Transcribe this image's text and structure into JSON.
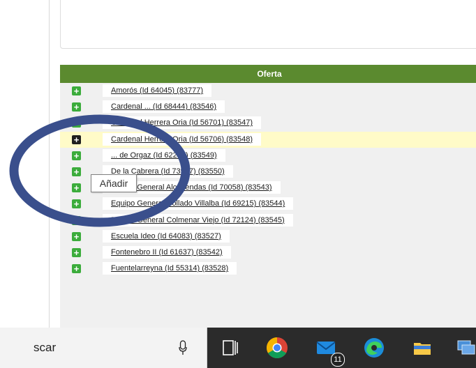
{
  "panel": {
    "header_label": "Oferta",
    "rows": [
      {
        "text": "Amorós (Id 64045) (83777)",
        "highlighted": false
      },
      {
        "text": "Cardenal ... (Id 68444) (83546)",
        "highlighted": false
      },
      {
        "text": "Cardenal Herrera Oria (Id 56701) (83547)",
        "highlighted": false
      },
      {
        "text": "Cardenal Herrera Oria (Id 56706) (83548)",
        "highlighted": true
      },
      {
        "text": "... de Orgaz (Id 62219) (83549)",
        "highlighted": false
      },
      {
        "text": "De la Cabrera (Id 73957) (83550)",
        "highlighted": false
      },
      {
        "text": "Equipo General Alcobendas (Id 70058) (83543)",
        "highlighted": false
      },
      {
        "text": "Equipo General Collado Villalba (Id 69215) (83544)",
        "highlighted": false
      },
      {
        "text": "Equipo General Colmenar Viejo (Id 72124) (83545)",
        "highlighted": false
      },
      {
        "text": "Escuela Ideo (Id 64083) (83527)",
        "highlighted": false
      },
      {
        "text": "Fontenebro II (Id 61637) (83542)",
        "highlighted": false
      },
      {
        "text": "Fuentelarreyna (Id 55314) (83528)",
        "highlighted": false
      }
    ]
  },
  "tooltip": {
    "text": "Añadir"
  },
  "taskbar": {
    "search_text": "scar",
    "mail_badge": "11",
    "icons": [
      "microphone-icon",
      "task-view-icon",
      "chrome-icon",
      "mail-icon",
      "edge-icon",
      "file-explorer-icon",
      "network-icon"
    ]
  },
  "colors": {
    "header_green": "#5b8a2f",
    "add_green": "#3bac3b",
    "row_highlight": "#fffbc8",
    "annotation_ellipse": "#3a4f8c"
  }
}
